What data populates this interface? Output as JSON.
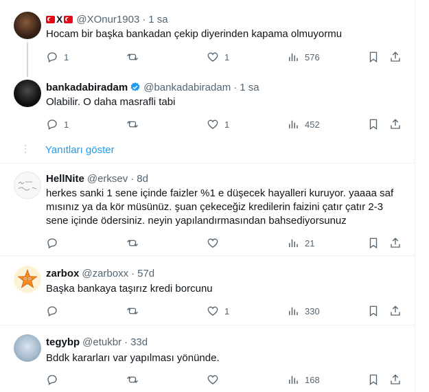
{
  "tweets": [
    {
      "handle": "@XOnur1903",
      "name_mark": "X",
      "dot": "·",
      "time": "1 sa",
      "text": "Hocam bir başka bankadan çekip diyerinden kapama olmuyormu",
      "replies": "1",
      "retweets": "",
      "likes": "1",
      "views": "576"
    },
    {
      "name": "bankadabiradam",
      "handle": "@bankadabiradam",
      "dot": "·",
      "time": "1 sa",
      "text": "Olabilir. O daha masrafli tabi",
      "replies": "1",
      "retweets": "",
      "likes": "1",
      "views": "452"
    },
    {
      "name": "HellNite",
      "handle": "@erksev",
      "dot": "·",
      "time": "8d",
      "text": "herkes sanki 1 sene içinde faizler %1 e düşecek hayalleri kuruyor. yaaaa saf mısınız ya da kör müsünüz. şuan çekeceğiz kredilerin faizini çatır çatır 2-3 sene içinde ödersiniz. neyin yapılandırmasından bahsediyorsunuz",
      "replies": "",
      "retweets": "",
      "likes": "",
      "views": "21"
    },
    {
      "name": "zarbox",
      "handle": "@zarboxx",
      "dot": "·",
      "time": "57d",
      "text": "Başka bankaya taşırız kredi borcunu",
      "replies": "",
      "retweets": "",
      "likes": "1",
      "views": "330"
    },
    {
      "name": "tegybp",
      "handle": "@etukbr",
      "dot": "·",
      "time": "33d",
      "text": "Bddk kararları var yapılması yönünde.",
      "replies": "",
      "retweets": "",
      "likes": "",
      "views": "168"
    }
  ],
  "show_replies_label": "Yanıtları göster",
  "colors": {
    "accent": "#1d9bf0",
    "muted": "#536471",
    "border": "#eff3f4",
    "verified": "#1d9bf0"
  }
}
